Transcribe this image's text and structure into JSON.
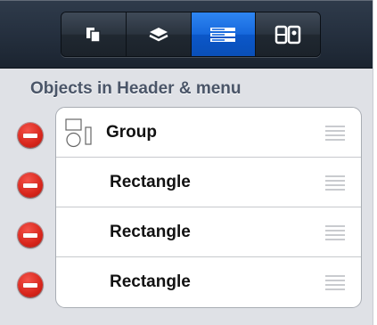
{
  "toolbar": {
    "segments": [
      {
        "icon": "pages-icon",
        "active": false
      },
      {
        "icon": "layers-icon",
        "active": false
      },
      {
        "icon": "objects-list-icon",
        "active": true
      },
      {
        "icon": "widgets-icon",
        "active": false
      }
    ],
    "active_color": "#1668dc"
  },
  "section": {
    "title": "Objects in Header & menu"
  },
  "objects": [
    {
      "label": "Group",
      "icon": "group-shapes-icon"
    },
    {
      "label": "Rectangle"
    },
    {
      "label": "Rectangle"
    },
    {
      "label": "Rectangle"
    }
  ],
  "colors": {
    "delete": "#d8261c",
    "panel": "#dfe1e6"
  }
}
